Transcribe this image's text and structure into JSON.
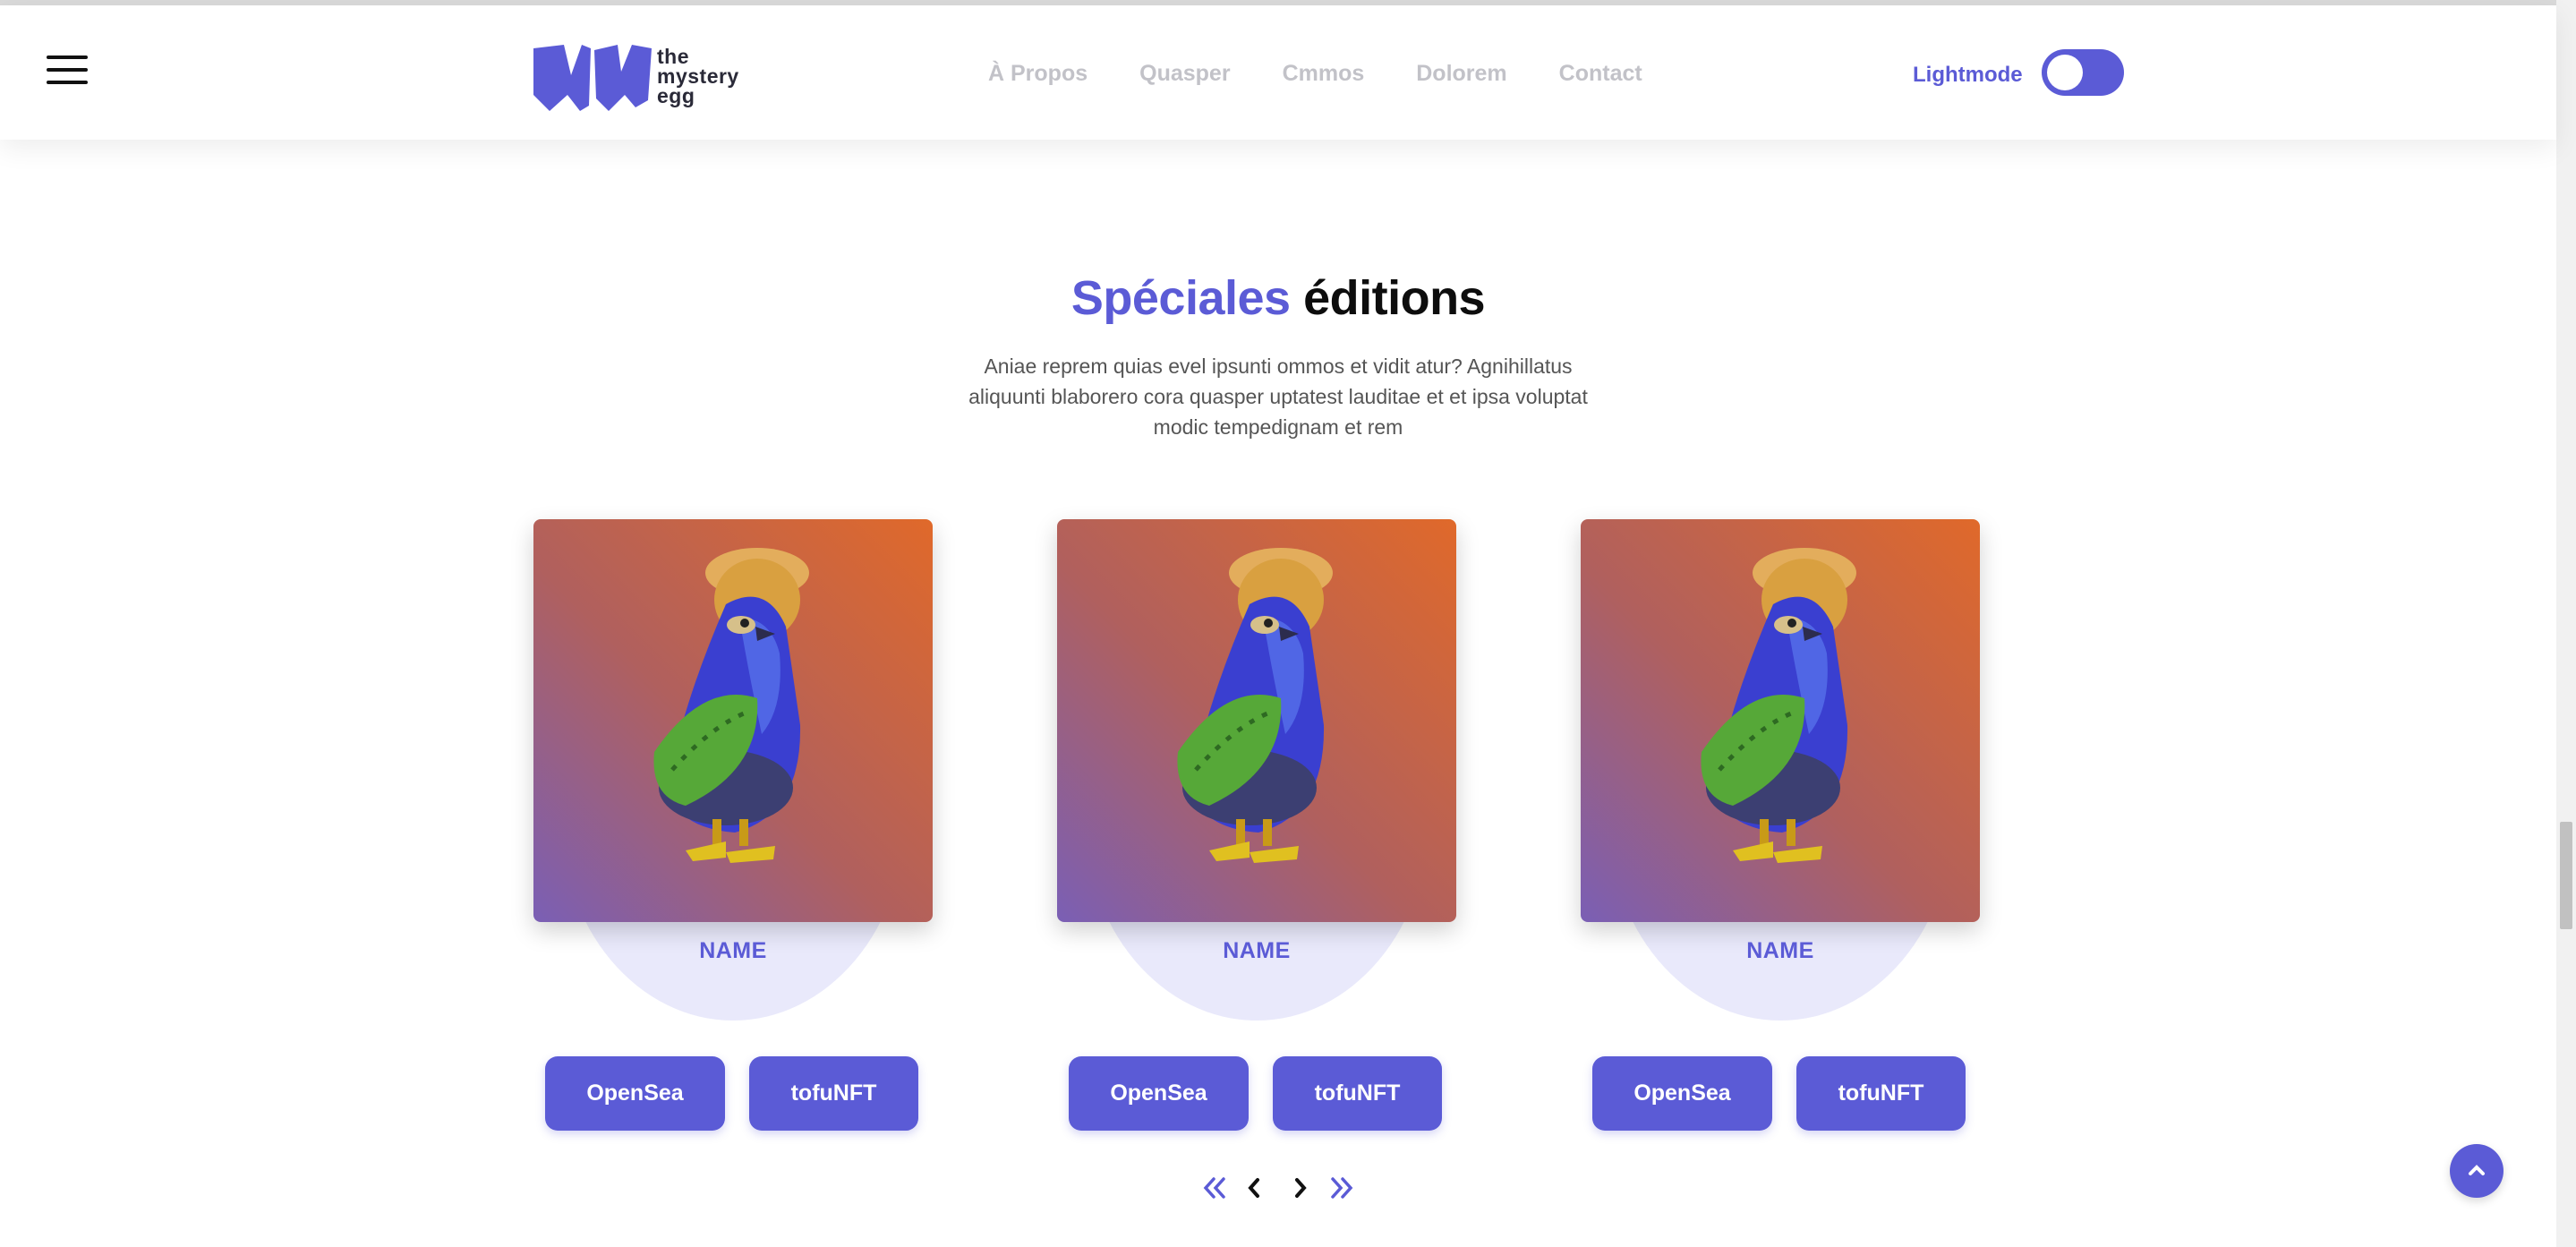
{
  "header": {
    "logo_text": [
      "the",
      "mystery",
      "egg"
    ],
    "nav": [
      "À Propos",
      "Quasper",
      "Cmmos",
      "Dolorem",
      "Contact"
    ],
    "mode_label": "Lightmode"
  },
  "section": {
    "title_accent": "Spéciales",
    "title_rest": "éditions",
    "description": "Aniae reprem quias evel ipsunti ommos et vidit atur? Agnihillatus aliquunti blaborero cora quasper uptatest lauditae et et ipsa voluptat modic tempedignam et rem"
  },
  "cards": [
    {
      "name": "NAME",
      "btn1": "OpenSea",
      "btn2": "tofuNFT"
    },
    {
      "name": "NAME",
      "btn1": "OpenSea",
      "btn2": "tofuNFT"
    },
    {
      "name": "NAME",
      "btn1": "OpenSea",
      "btn2": "tofuNFT"
    }
  ],
  "colors": {
    "accent": "#5b5bd6",
    "nav_inactive": "#c2c2c8",
    "ellipse": "#e9e9fb"
  },
  "icons": {
    "menu": "hamburger-icon",
    "first": "double-chevron-left-icon",
    "prev": "chevron-left-icon",
    "next": "chevron-right-icon",
    "last": "double-chevron-right-icon",
    "top": "chevron-up-icon"
  }
}
